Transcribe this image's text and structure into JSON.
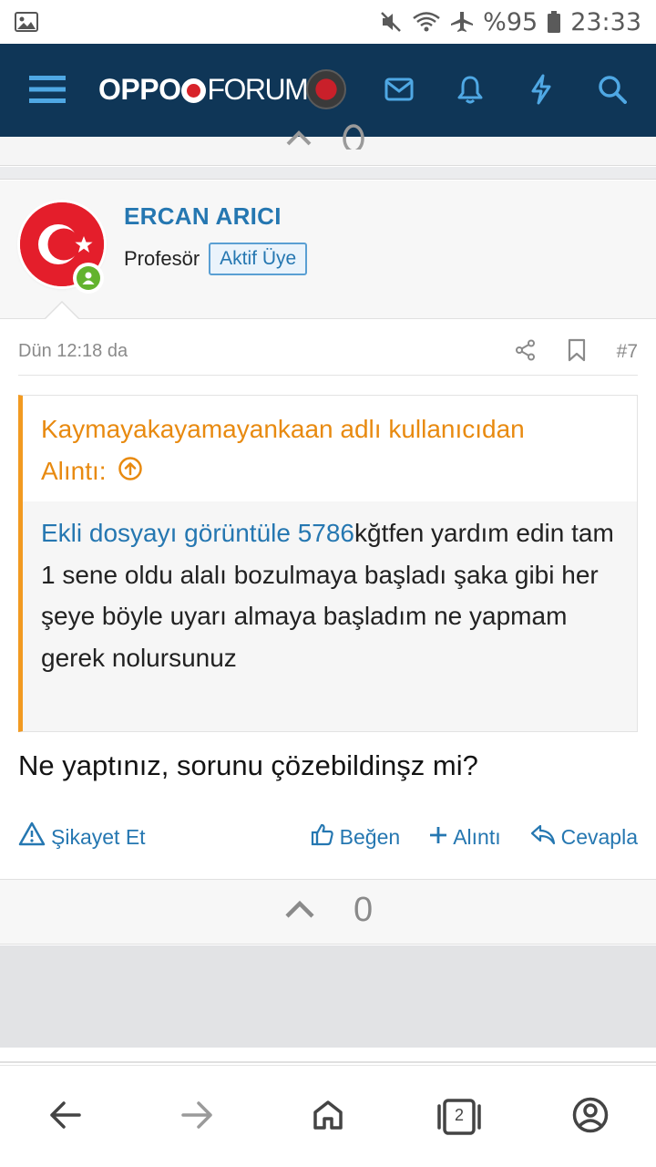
{
  "status_bar": {
    "battery": "%95",
    "time": "23:33",
    "icons": [
      "image-icon",
      "mute-icon",
      "wifi-icon",
      "airplane-icon",
      "battery-icon"
    ]
  },
  "header": {
    "logo_bold": "OPPO",
    "logo_light": "FORUM",
    "icons": [
      "menu-icon",
      "avatar",
      "envelope-icon",
      "bell-icon",
      "bolt-icon",
      "search-icon"
    ],
    "colors": {
      "background": "#0f3657",
      "icon": "#4fa8e4"
    }
  },
  "post": {
    "username": "ERCAN ARICI",
    "user_rank": "Profesör",
    "user_badge": "Aktif Üye",
    "date": "Dün 12:18 da",
    "post_number": "#7",
    "quote": {
      "author_line": "Kaymayakayamayankaan adlı kullanıcıdan",
      "label": "Alıntı:",
      "link_text": "Ekli dosyayı görüntüle 5786",
      "text": "kğtfen yardım edin tam 1 sene oldu alalı bozulmaya başladı şaka gibi her şeye böyle uyarı almaya başladım ne yapmam gerek nolursunuz"
    },
    "message": "Ne yaptınız, sorunu çözebildinşz mi?",
    "actions": {
      "report": "Şikayet Et",
      "like": "Beğen",
      "quote": "Alıntı",
      "reply": "Cevapla"
    },
    "vote_count": "0",
    "colors": {
      "link": "#2577b1",
      "quote_accent": "#f29a21",
      "online": "#63b32e"
    }
  },
  "bottom_nav": {
    "tab_count": "2",
    "icons": [
      "back-icon",
      "forward-icon",
      "home-icon",
      "tabs-icon",
      "account-icon"
    ]
  }
}
